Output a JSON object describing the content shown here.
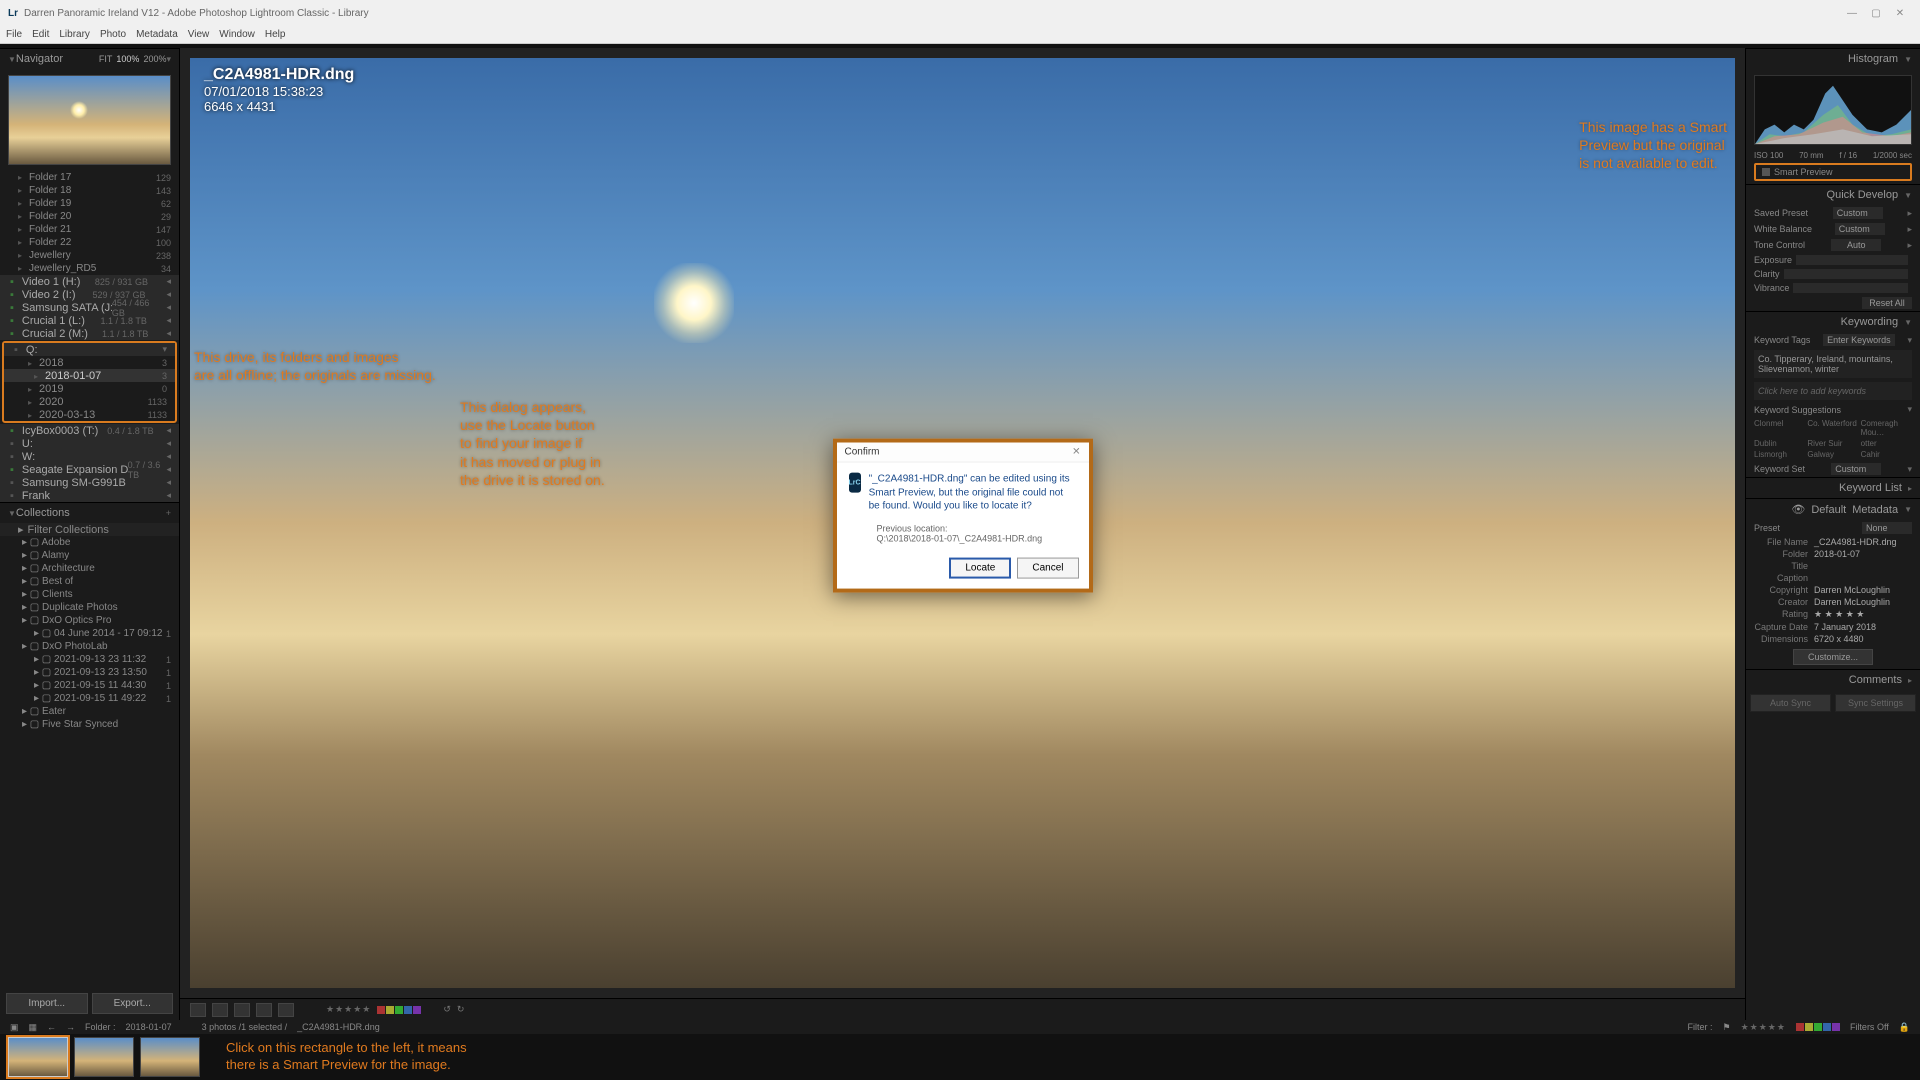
{
  "window": {
    "title": "Darren Panoramic Ireland V12 - Adobe Photoshop Lightroom Classic - Library",
    "app_icon": "Lr"
  },
  "menu": [
    "File",
    "Edit",
    "Library",
    "Photo",
    "Metadata",
    "View",
    "Window",
    "Help"
  ],
  "navigator": {
    "title": "Navigator",
    "fit": "FIT",
    "pct1": "100%",
    "pct2": "200%"
  },
  "folders": [
    {
      "name": "Folder 17",
      "count": "129"
    },
    {
      "name": "Folder 18",
      "count": "143"
    },
    {
      "name": "Folder 19",
      "count": "62"
    },
    {
      "name": "Folder 20",
      "count": "29"
    },
    {
      "name": "Folder 21",
      "count": "147"
    },
    {
      "name": "Folder 22",
      "count": "100"
    },
    {
      "name": "Jewellery",
      "count": "238"
    },
    {
      "name": "Jewellery_RD5",
      "count": "34"
    }
  ],
  "volumes": [
    {
      "name": "Video 1 (H:)",
      "info": "825 / 931 GB"
    },
    {
      "name": "Video 2 (I:)",
      "info": "529 / 937 GB"
    },
    {
      "name": "Samsung SATA (J:)",
      "info": "454 / 466 GB"
    },
    {
      "name": "Crucial 1 (L:)",
      "info": "1.1 / 1.8 TB"
    },
    {
      "name": "Crucial 2 (M:)",
      "info": "1.1 / 1.8 TB"
    }
  ],
  "q_drive": {
    "label": "Q:",
    "children": [
      {
        "name": "2018",
        "count": "3"
      },
      {
        "name": "2018-01-07",
        "count": "3",
        "selected": true
      },
      {
        "name": "2019",
        "count": "0"
      },
      {
        "name": "2020",
        "count": "1133"
      },
      {
        "name": "2020-03-13",
        "count": "1133"
      }
    ]
  },
  "more_vols": [
    {
      "name": "IcyBox0003 (T:)",
      "info": "0.4 / 1.8 TB"
    },
    {
      "name": "U:",
      "info": ""
    },
    {
      "name": "W:",
      "info": ""
    },
    {
      "name": "Seagate Expansion Drive (X:)",
      "info": "0.7 / 3.6 TB"
    },
    {
      "name": "Samsung SM-G991B",
      "info": ""
    },
    {
      "name": "Frank",
      "info": ""
    }
  ],
  "collections_title": "Collections",
  "filter_collections": "Filter Collections",
  "collections": [
    "Adobe",
    "Alamy",
    "Architecture",
    "Best of",
    "Clients",
    "Duplicate Photos",
    "DxO Optics Pro",
    "04 June 2014 - 17 09:12",
    "DxO PhotoLab",
    "2021-09-13 23 11:32",
    "2021-09-13 23 13:50",
    "2021-09-15 11 44:30",
    "2021-09-15 11 49:22",
    "Eater",
    "Five Star Synced"
  ],
  "coll_counts": [
    "",
    "",
    "",
    "",
    "",
    "",
    "",
    "1",
    "",
    "1",
    "1",
    "1",
    "1",
    "",
    ""
  ],
  "import": "Import...",
  "export": "Export...",
  "image": {
    "filename": "_C2A4981-HDR.dng",
    "datetime": "07/01/2018 15:38:23",
    "dims": "6646 x 4431"
  },
  "annotations": {
    "a1": "This drive, its folders and images\nare all offline; the originals are missing.",
    "a2": "This dialog appears,\nuse the Locate button\nto find your image if\nit has moved or plug in\nthe drive it is stored on.",
    "a3": "This image has a Smart\nPreview but the original\nis not available to edit.",
    "a4": "Click on this rectangle to the left, it means\nthere is a Smart Preview for the image."
  },
  "dialog": {
    "title": "Confirm",
    "message": "\"_C2A4981-HDR.dng\" can be edited using its Smart Preview, but the original file could not be found. Would you like to locate it?",
    "prev_label": "Previous location:",
    "prev_path": "Q:\\2018\\2018-01-07\\_C2A4981-HDR.dng",
    "locate": "Locate",
    "cancel": "Cancel"
  },
  "histogram": {
    "title": "Histogram",
    "iso": "ISO 100",
    "mm": "70 mm",
    "f": "f / 16",
    "shutter": "1/2000 sec",
    "smart_preview": "Smart Preview"
  },
  "quick_develop": {
    "title": "Quick Develop",
    "saved_preset_lbl": "Saved Preset",
    "saved_preset": "Custom",
    "wb_lbl": "White Balance",
    "wb": "Custom",
    "tone_lbl": "Tone Control",
    "auto": "Auto",
    "exposure": "Exposure",
    "clarity": "Clarity",
    "vibrance": "Vibrance",
    "reset": "Reset All"
  },
  "keywording": {
    "title": "Keywording",
    "tags_lbl": "Keyword Tags",
    "enter": "Enter Keywords",
    "tags_val": "Co. Tipperary, Ireland, mountains, Slievenamon, winter",
    "click_here": "Click here to add keywords",
    "sugg_title": "Keyword Suggestions",
    "sugg": [
      "Clonmel",
      "Co. Waterford",
      "Comeragh Mou…",
      "Dublin",
      "River Suir",
      "otter",
      "Lismorgh",
      "Galway",
      "Cahir"
    ],
    "set_lbl": "Keyword Set",
    "set_val": "Custom"
  },
  "keyword_list_title": "Keyword List",
  "metadata": {
    "title": "Metadata",
    "default": "Default",
    "preset_lbl": "Preset",
    "preset": "None",
    "rows": [
      {
        "lbl": "File Name",
        "val": "_C2A4981-HDR.dng"
      },
      {
        "lbl": "Folder",
        "val": "2018-01-07"
      },
      {
        "lbl": "Title",
        "val": ""
      },
      {
        "lbl": "Caption",
        "val": ""
      },
      {
        "lbl": "Copyright",
        "val": "Darren McLoughlin"
      },
      {
        "lbl": "Creator",
        "val": "Darren McLoughlin"
      },
      {
        "lbl": "Rating",
        "val": "★ ★ ★ ★ ★"
      },
      {
        "lbl": "Capture Date",
        "val": "7 January 2018"
      },
      {
        "lbl": "Dimensions",
        "val": "6720 x 4480"
      }
    ],
    "customize": "Customize..."
  },
  "comments_title": "Comments",
  "sync": {
    "auto": "Auto Sync",
    "settings": "Sync Settings"
  },
  "filmstrip": {
    "path_label": "Folder :",
    "path": "2018-01-07",
    "status": "3 photos /1 selected /",
    "current": "_C2A4981-HDR.dng",
    "filter": "Filter :",
    "filters_off": "Filters Off"
  }
}
